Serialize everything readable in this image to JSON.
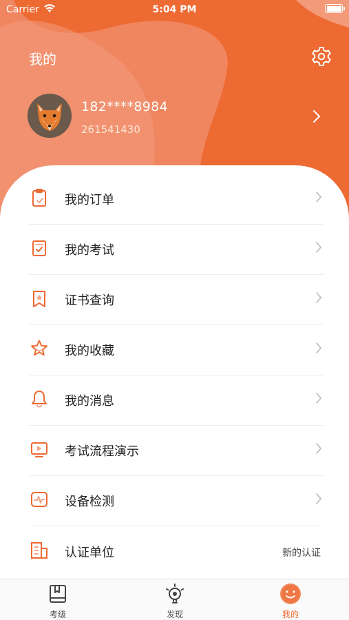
{
  "status_bar": {
    "carrier": "Carrier",
    "time": "5:04 PM"
  },
  "header": {
    "title": "我的",
    "settings_icon": "gear-icon"
  },
  "profile": {
    "phone": "182****8984",
    "user_id": "261541430"
  },
  "menu": [
    {
      "id": "orders",
      "label": "我的订单",
      "icon": "clipboard-icon"
    },
    {
      "id": "exams",
      "label": "我的考试",
      "icon": "exam-check-icon"
    },
    {
      "id": "certificates",
      "label": "证书查询",
      "icon": "bookmark-star-icon"
    },
    {
      "id": "favorites",
      "label": "我的收藏",
      "icon": "star-icon"
    },
    {
      "id": "messages",
      "label": "我的消息",
      "icon": "bell-icon"
    },
    {
      "id": "exam-flow",
      "label": "考试流程演示",
      "icon": "play-screen-icon"
    },
    {
      "id": "device-check",
      "label": "设备检测",
      "icon": "device-pulse-icon"
    },
    {
      "id": "cert-unit",
      "label": "认证单位",
      "icon": "building-icon",
      "trailing": "新的认证"
    }
  ],
  "tabbar": [
    {
      "label": "考级",
      "icon": "book-icon"
    },
    {
      "label": "发现",
      "icon": "lightbulb-icon"
    },
    {
      "label": "我的",
      "icon": "smiley-icon",
      "active": true
    }
  ],
  "colors": {
    "accent": "#ee6a33",
    "accent_light": "#f3a58a"
  }
}
